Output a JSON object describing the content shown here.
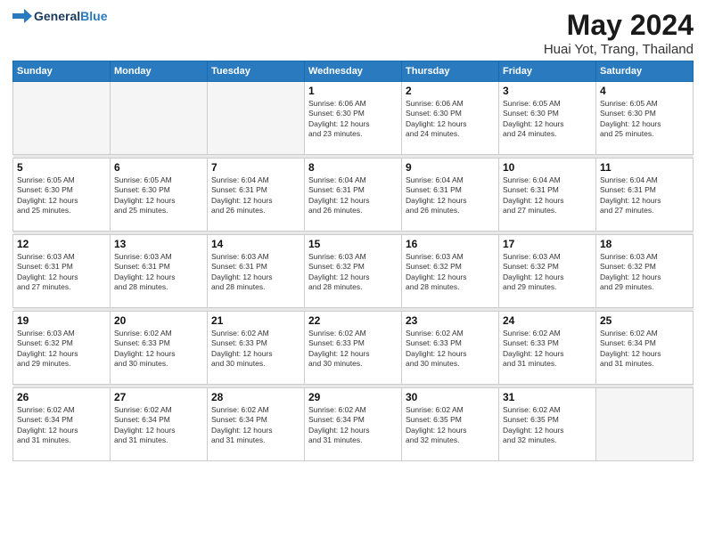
{
  "header": {
    "logo_general": "General",
    "logo_blue": "Blue",
    "title": "May 2024",
    "subtitle": "Huai Yot, Trang, Thailand"
  },
  "weekdays": [
    "Sunday",
    "Monday",
    "Tuesday",
    "Wednesday",
    "Thursday",
    "Friday",
    "Saturday"
  ],
  "weeks": [
    [
      {
        "day": "",
        "info": ""
      },
      {
        "day": "",
        "info": ""
      },
      {
        "day": "",
        "info": ""
      },
      {
        "day": "1",
        "info": "Sunrise: 6:06 AM\nSunset: 6:30 PM\nDaylight: 12 hours\nand 23 minutes."
      },
      {
        "day": "2",
        "info": "Sunrise: 6:06 AM\nSunset: 6:30 PM\nDaylight: 12 hours\nand 24 minutes."
      },
      {
        "day": "3",
        "info": "Sunrise: 6:05 AM\nSunset: 6:30 PM\nDaylight: 12 hours\nand 24 minutes."
      },
      {
        "day": "4",
        "info": "Sunrise: 6:05 AM\nSunset: 6:30 PM\nDaylight: 12 hours\nand 25 minutes."
      }
    ],
    [
      {
        "day": "5",
        "info": "Sunrise: 6:05 AM\nSunset: 6:30 PM\nDaylight: 12 hours\nand 25 minutes."
      },
      {
        "day": "6",
        "info": "Sunrise: 6:05 AM\nSunset: 6:30 PM\nDaylight: 12 hours\nand 25 minutes."
      },
      {
        "day": "7",
        "info": "Sunrise: 6:04 AM\nSunset: 6:31 PM\nDaylight: 12 hours\nand 26 minutes."
      },
      {
        "day": "8",
        "info": "Sunrise: 6:04 AM\nSunset: 6:31 PM\nDaylight: 12 hours\nand 26 minutes."
      },
      {
        "day": "9",
        "info": "Sunrise: 6:04 AM\nSunset: 6:31 PM\nDaylight: 12 hours\nand 26 minutes."
      },
      {
        "day": "10",
        "info": "Sunrise: 6:04 AM\nSunset: 6:31 PM\nDaylight: 12 hours\nand 27 minutes."
      },
      {
        "day": "11",
        "info": "Sunrise: 6:04 AM\nSunset: 6:31 PM\nDaylight: 12 hours\nand 27 minutes."
      }
    ],
    [
      {
        "day": "12",
        "info": "Sunrise: 6:03 AM\nSunset: 6:31 PM\nDaylight: 12 hours\nand 27 minutes."
      },
      {
        "day": "13",
        "info": "Sunrise: 6:03 AM\nSunset: 6:31 PM\nDaylight: 12 hours\nand 28 minutes."
      },
      {
        "day": "14",
        "info": "Sunrise: 6:03 AM\nSunset: 6:31 PM\nDaylight: 12 hours\nand 28 minutes."
      },
      {
        "day": "15",
        "info": "Sunrise: 6:03 AM\nSunset: 6:32 PM\nDaylight: 12 hours\nand 28 minutes."
      },
      {
        "day": "16",
        "info": "Sunrise: 6:03 AM\nSunset: 6:32 PM\nDaylight: 12 hours\nand 28 minutes."
      },
      {
        "day": "17",
        "info": "Sunrise: 6:03 AM\nSunset: 6:32 PM\nDaylight: 12 hours\nand 29 minutes."
      },
      {
        "day": "18",
        "info": "Sunrise: 6:03 AM\nSunset: 6:32 PM\nDaylight: 12 hours\nand 29 minutes."
      }
    ],
    [
      {
        "day": "19",
        "info": "Sunrise: 6:03 AM\nSunset: 6:32 PM\nDaylight: 12 hours\nand 29 minutes."
      },
      {
        "day": "20",
        "info": "Sunrise: 6:02 AM\nSunset: 6:33 PM\nDaylight: 12 hours\nand 30 minutes."
      },
      {
        "day": "21",
        "info": "Sunrise: 6:02 AM\nSunset: 6:33 PM\nDaylight: 12 hours\nand 30 minutes."
      },
      {
        "day": "22",
        "info": "Sunrise: 6:02 AM\nSunset: 6:33 PM\nDaylight: 12 hours\nand 30 minutes."
      },
      {
        "day": "23",
        "info": "Sunrise: 6:02 AM\nSunset: 6:33 PM\nDaylight: 12 hours\nand 30 minutes."
      },
      {
        "day": "24",
        "info": "Sunrise: 6:02 AM\nSunset: 6:33 PM\nDaylight: 12 hours\nand 31 minutes."
      },
      {
        "day": "25",
        "info": "Sunrise: 6:02 AM\nSunset: 6:34 PM\nDaylight: 12 hours\nand 31 minutes."
      }
    ],
    [
      {
        "day": "26",
        "info": "Sunrise: 6:02 AM\nSunset: 6:34 PM\nDaylight: 12 hours\nand 31 minutes."
      },
      {
        "day": "27",
        "info": "Sunrise: 6:02 AM\nSunset: 6:34 PM\nDaylight: 12 hours\nand 31 minutes."
      },
      {
        "day": "28",
        "info": "Sunrise: 6:02 AM\nSunset: 6:34 PM\nDaylight: 12 hours\nand 31 minutes."
      },
      {
        "day": "29",
        "info": "Sunrise: 6:02 AM\nSunset: 6:34 PM\nDaylight: 12 hours\nand 31 minutes."
      },
      {
        "day": "30",
        "info": "Sunrise: 6:02 AM\nSunset: 6:35 PM\nDaylight: 12 hours\nand 32 minutes."
      },
      {
        "day": "31",
        "info": "Sunrise: 6:02 AM\nSunset: 6:35 PM\nDaylight: 12 hours\nand 32 minutes."
      },
      {
        "day": "",
        "info": ""
      }
    ]
  ]
}
